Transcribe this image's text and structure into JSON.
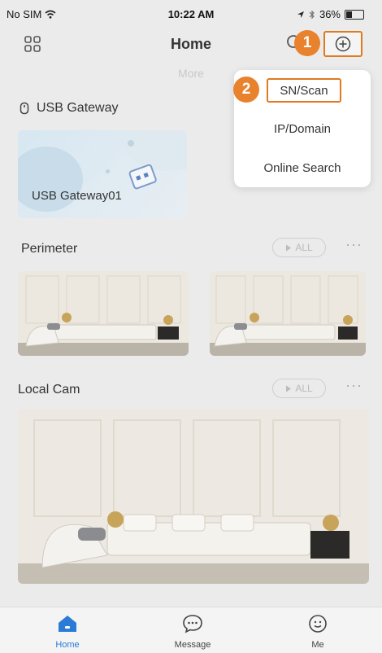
{
  "status_bar": {
    "carrier": "No SIM",
    "time": "10:22 AM",
    "battery": "36%"
  },
  "header": {
    "title": "Home",
    "more_label": "More"
  },
  "callouts": {
    "step1": "1",
    "step2": "2"
  },
  "dropdown": {
    "items": [
      "SN/Scan",
      "IP/Domain",
      "Online Search"
    ]
  },
  "gateway_section": {
    "title": "USB Gateway",
    "card_label": "USB Gateway01"
  },
  "perimeter_section": {
    "title": "Perimeter",
    "all_label": "ALL"
  },
  "local_cam_section": {
    "title": "Local Cam",
    "all_label": "ALL"
  },
  "tabbar": {
    "items": [
      "Home",
      "Message",
      "Me"
    ],
    "active_color": "#2a7bd6"
  },
  "colors": {
    "accent": "#e8822c",
    "background": "#ebebeb"
  }
}
